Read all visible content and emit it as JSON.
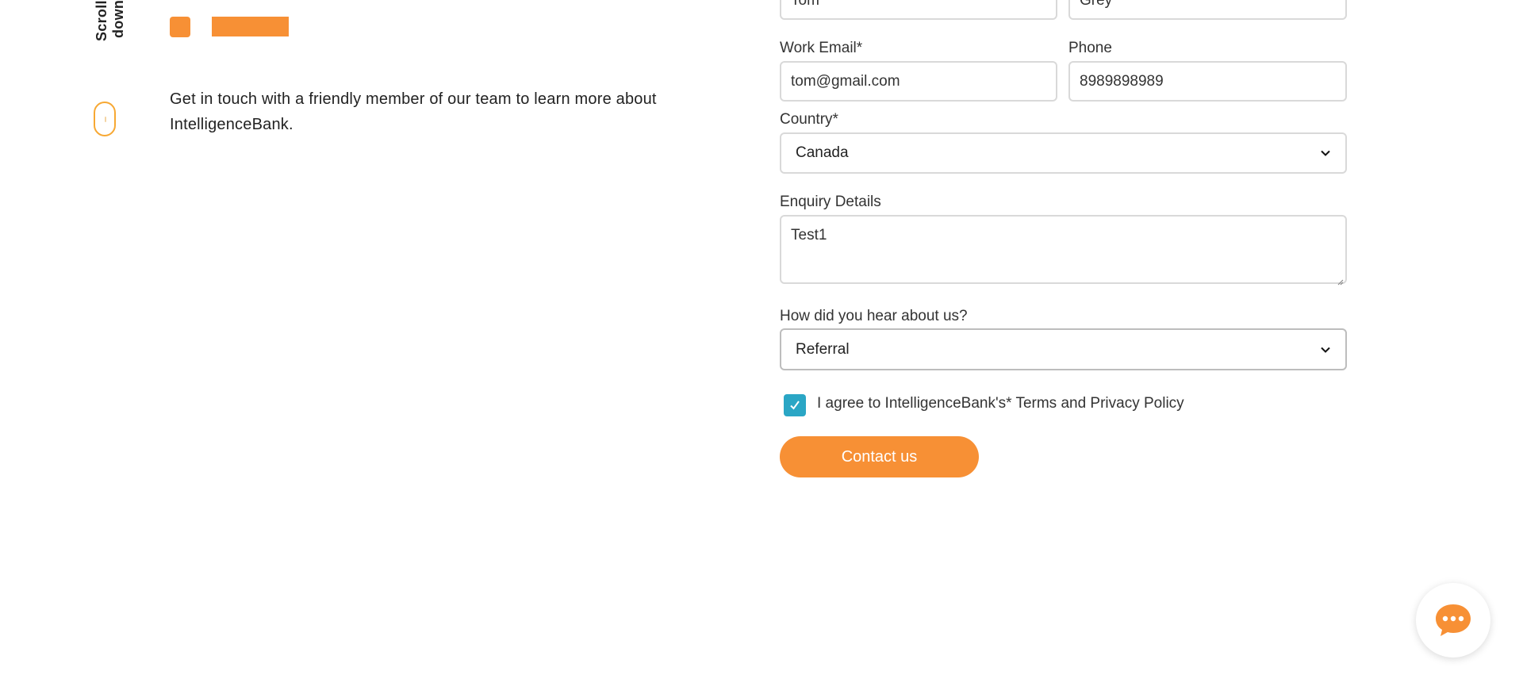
{
  "sidebar": {
    "scroll_label": "Scroll down"
  },
  "intro": {
    "text": "Get in touch with a friendly member of our team to learn more about IntelligenceBank."
  },
  "form": {
    "first_name_value": "Tom",
    "last_name_value": "Grey",
    "work_email_label": "Work Email*",
    "work_email_value": "tom@gmail.com",
    "phone_label": "Phone",
    "phone_value": "8989898989",
    "country_label": "Country*",
    "country_value": "Canada",
    "enquiry_label": "Enquiry Details",
    "enquiry_value": "Test1",
    "hear_label": "How did you hear about us?",
    "hear_value": "Referral",
    "agree_label": "I agree to IntelligenceBank's* Terms and Privacy Policy",
    "agree_checked": true,
    "submit_label": "Contact us"
  },
  "colors": {
    "accent": "#f79035",
    "checkbox": "#2aa6c5",
    "scroll_outline": "#f7a833"
  },
  "icons": {
    "chat": "chat-bubble-icon",
    "chevron": "chevron-down-icon",
    "check": "checkmark-icon"
  }
}
